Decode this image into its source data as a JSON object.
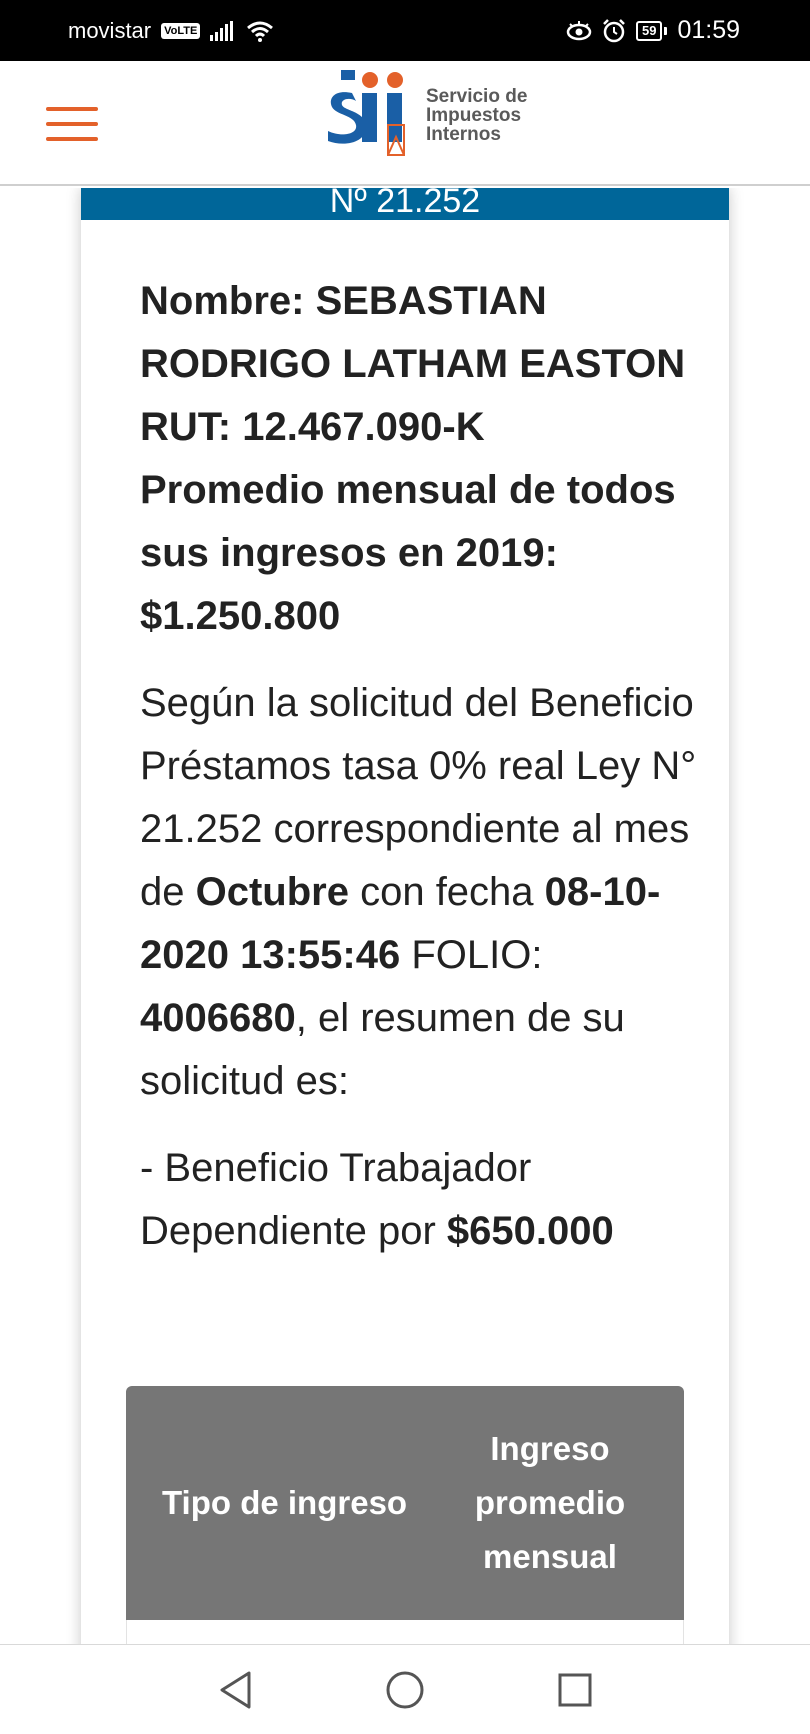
{
  "status_bar": {
    "carrier": "movistar",
    "volte": "VoLTE",
    "battery": "59",
    "time": "01:59"
  },
  "header": {
    "logo_text": [
      "Servicio de",
      "Impuestos",
      "Internos"
    ],
    "brand_orange": "#e3612a",
    "brand_blue": "#1a5fa6"
  },
  "card": {
    "banner": "Nº 21.252",
    "banner_color": "#006699",
    "name_line": "Nombre: SEBASTIAN RODRIGO LATHAM EASTON",
    "rut_line": "RUT: 12.467.090-K",
    "average_line": "Promedio mensual de todos sus ingresos en 2019: $1.250.800",
    "paragraph": {
      "p1": "Según la solicitud del Beneficio Préstamos tasa 0% real Ley N° 21.252 correspondiente al mes de ",
      "month": "Octubre",
      "p2": " con fecha ",
      "date": "08-10-2020 13:55:46",
      "p3": " FOLIO: ",
      "folio": "4006680",
      "p4": ", el resumen de su solicitud es:"
    },
    "benefit": {
      "text": "- Beneficio Trabajador Dependiente por ",
      "amount": "$650.000"
    },
    "table": {
      "col1": "Tipo de ingreso",
      "col2": "Ingreso promedio mensual"
    }
  },
  "navbar": {
    "back": "back-icon",
    "home": "home-icon",
    "recents": "recents-icon"
  }
}
